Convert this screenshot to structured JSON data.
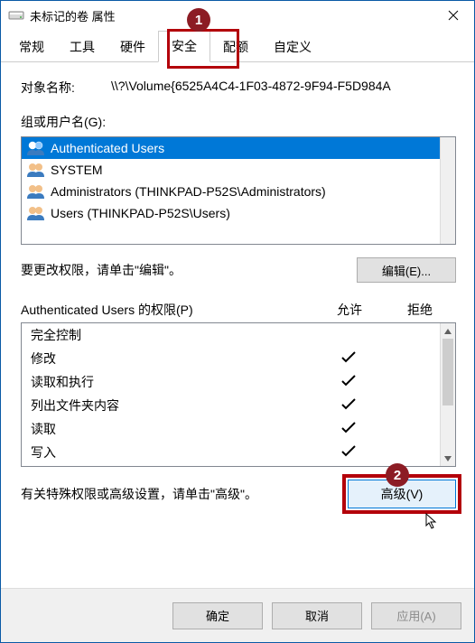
{
  "titlebar": {
    "title": "未标记的卷 属性"
  },
  "tabs": {
    "items": [
      "常规",
      "工具",
      "硬件",
      "安全",
      "配额",
      "自定义"
    ],
    "active_index": 3
  },
  "object": {
    "label": "对象名称:",
    "value": "\\\\?\\Volume{6525A4C4-1F03-4872-9F94-F5D984A"
  },
  "groups": {
    "label": "组或用户名(G):",
    "items": [
      {
        "name": "Authenticated Users",
        "selected": true
      },
      {
        "name": "SYSTEM",
        "selected": false
      },
      {
        "name": "Administrators (THINKPAD-P52S\\Administrators)",
        "selected": false
      },
      {
        "name": "Users (THINKPAD-P52S\\Users)",
        "selected": false
      }
    ]
  },
  "edit": {
    "text": "要更改权限，请单击\"编辑\"。",
    "button": "编辑(E)..."
  },
  "perm": {
    "header_name": "Authenticated Users 的权限(P)",
    "header_allow": "允许",
    "header_deny": "拒绝",
    "rows": [
      {
        "name": "完全控制",
        "allow": false,
        "deny": false
      },
      {
        "name": "修改",
        "allow": true,
        "deny": false
      },
      {
        "name": "读取和执行",
        "allow": true,
        "deny": false
      },
      {
        "name": "列出文件夹内容",
        "allow": true,
        "deny": false
      },
      {
        "name": "读取",
        "allow": true,
        "deny": false
      },
      {
        "name": "写入",
        "allow": true,
        "deny": false
      }
    ]
  },
  "advanced": {
    "text": "有关特殊权限或高级设置，请单击\"高级\"。",
    "button": "高级(V)"
  },
  "footer": {
    "ok": "确定",
    "cancel": "取消",
    "apply": "应用(A)"
  },
  "badges": {
    "one": "1",
    "two": "2"
  }
}
